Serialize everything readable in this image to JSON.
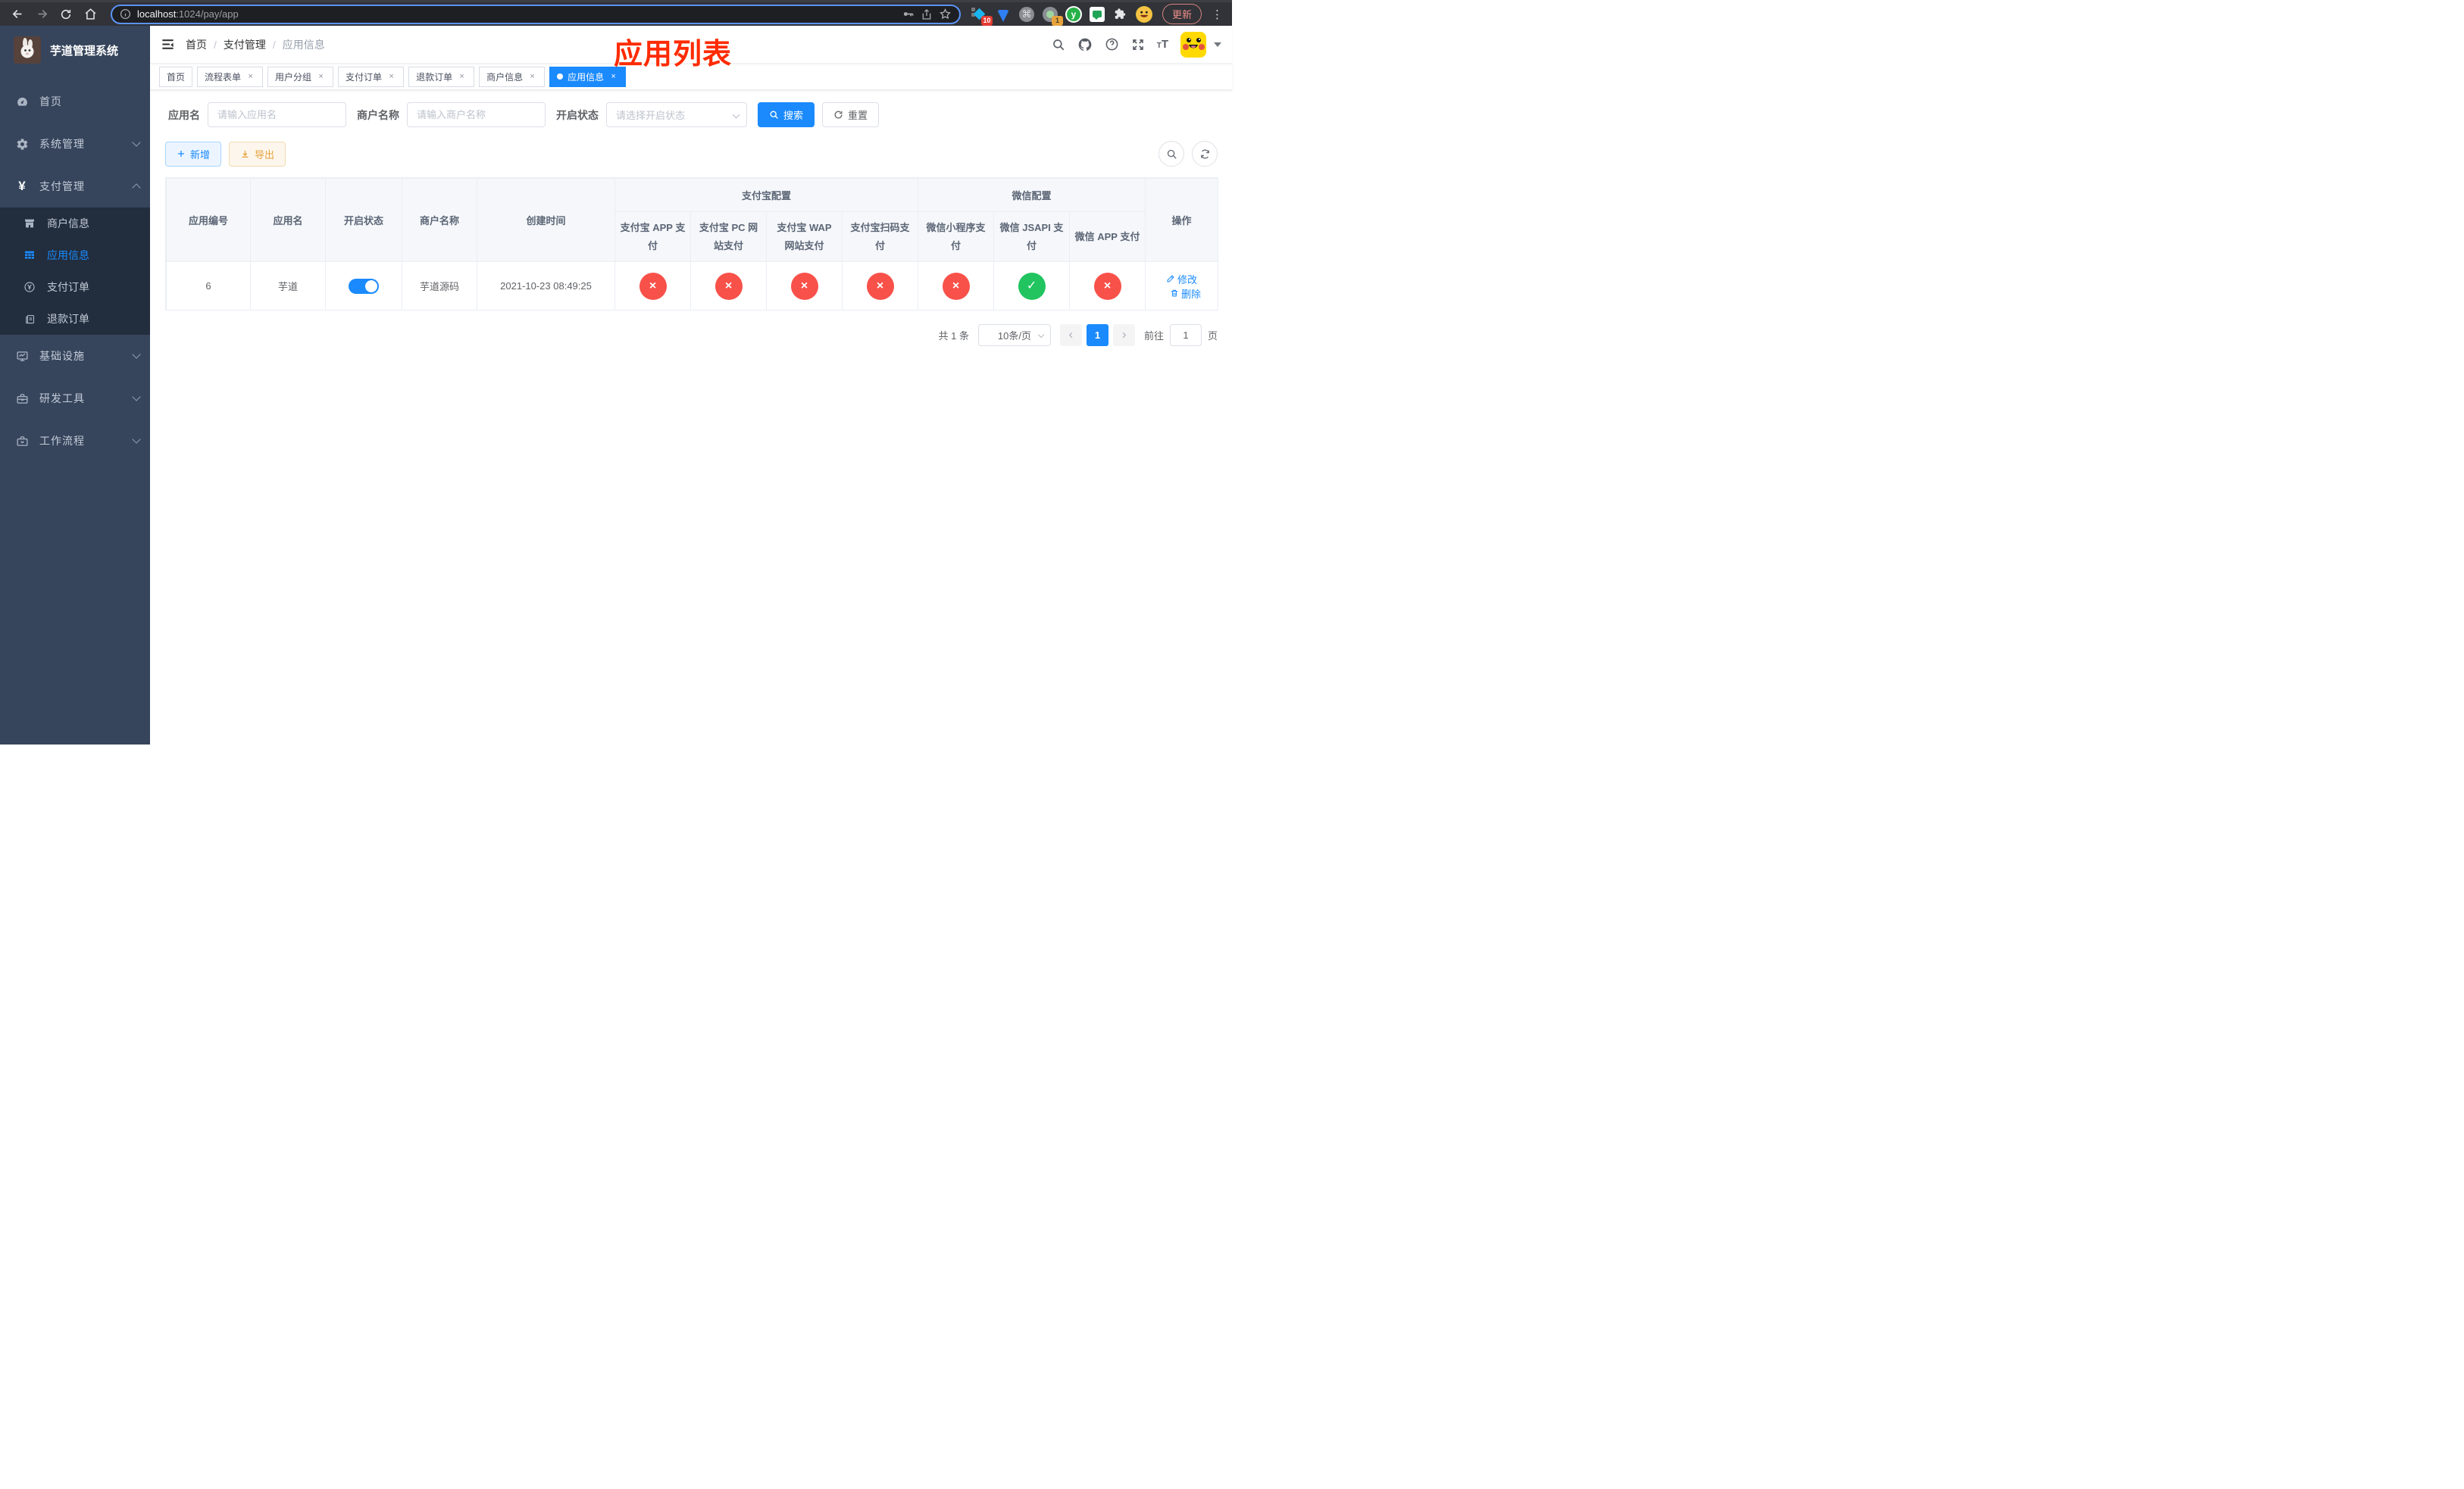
{
  "colors": {
    "primary": "#1a8afd",
    "success": "#21c45f",
    "danger": "#f8514a",
    "warning": "#e6a23c",
    "annotation": "#ff2b00"
  },
  "browser": {
    "url_host": "localhost",
    "url_rest": ":1024/pay/app",
    "ext_badge_1": "10",
    "ext_badge_2": "1",
    "y_ext_letter": "y",
    "cmd_glyph": "⌘",
    "update_label": "更新",
    "menu_glyph": "⋮"
  },
  "sidebar": {
    "title": "芋道管理系统",
    "home": "首页",
    "system": "系统管理",
    "payment": "支付管理",
    "merchant": "商户信息",
    "app_info": "应用信息",
    "pay_order": "支付订单",
    "refund_order": "退款订单",
    "infra": "基础设施",
    "dev_tools": "研发工具",
    "workflow": "工作流程",
    "yen_glyph": "¥"
  },
  "navbar": {
    "breadcrumb_home": "首页",
    "breadcrumb_payment": "支付管理",
    "breadcrumb_current": "应用信息",
    "separator": "/",
    "annotation": "应用列表"
  },
  "tabs": {
    "t0": "首页",
    "t1": "流程表单",
    "t2": "用户分组",
    "t3": "支付订单",
    "t4": "退款订单",
    "t5": "商户信息",
    "t6": "应用信息",
    "close": "×"
  },
  "filters": {
    "app_name_label": "应用名",
    "app_name_placeholder": "请输入应用名",
    "merchant_label": "商户名称",
    "merchant_placeholder": "请输入商户名称",
    "status_label": "开启状态",
    "status_placeholder": "请选择开启状态",
    "search_label": "搜索",
    "reset_label": "重置"
  },
  "toolbar": {
    "add_label": "新增",
    "export_label": "导出"
  },
  "table": {
    "headers": {
      "app_id": "应用编号",
      "app_name": "应用名",
      "status": "开启状态",
      "merchant": "商户名称",
      "created": "创建时间",
      "alipay_group": "支付宝配置",
      "wechat_group": "微信配置",
      "alipay_app": "支付宝 APP 支付",
      "alipay_pc": "支付宝 PC 网站支付",
      "alipay_wap": "支付宝 WAP 网站支付",
      "alipay_qr": "支付宝扫码支付",
      "wx_lite": "微信小程序支付",
      "wx_jsapi": "微信 JSAPI 支付",
      "wx_app": "微信 APP 支付",
      "actions": "操作"
    },
    "row": {
      "app_id": "6",
      "app_name": "芋道",
      "enabled": true,
      "merchant": "芋道源码",
      "created": "2021-10-23 08:49:25",
      "channel_statuses": [
        "cross",
        "cross",
        "cross",
        "cross",
        "cross",
        "check",
        "cross"
      ],
      "edit": "修改",
      "delete": "删除"
    }
  },
  "icons": {
    "check": "✓",
    "cross": "×"
  },
  "pagination": {
    "total": "共 1 条",
    "page_size": "10条/页",
    "page_1": "1",
    "goto_prefix": "前往",
    "goto_value": "1",
    "goto_suffix": "页"
  }
}
